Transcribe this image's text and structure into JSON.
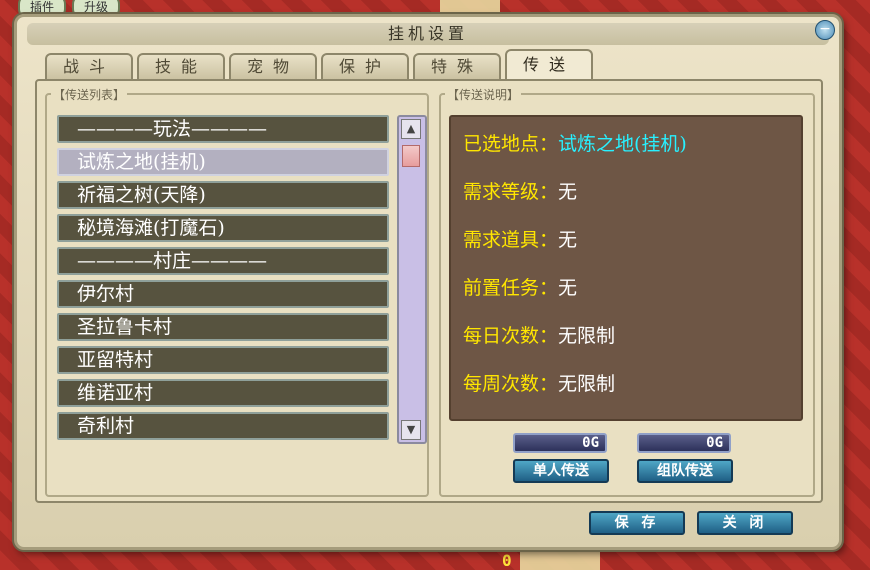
{
  "window": {
    "title": "挂机设置",
    "close_glyph": "−"
  },
  "background": {
    "top_buttons": [
      "插件",
      "升级"
    ],
    "bottom_number": "0"
  },
  "tabs": [
    {
      "label": "战斗",
      "active": false
    },
    {
      "label": "技能",
      "active": false
    },
    {
      "label": "宠物",
      "active": false
    },
    {
      "label": "保护",
      "active": false
    },
    {
      "label": "特殊",
      "active": false
    },
    {
      "label": "传送",
      "active": true
    }
  ],
  "teleport_list": {
    "group_label": "【传送列表】",
    "items": [
      {
        "label": "————玩法————",
        "type": "header"
      },
      {
        "label": "试炼之地(挂机)",
        "type": "item",
        "selected": true
      },
      {
        "label": "祈福之树(天降)",
        "type": "item"
      },
      {
        "label": "秘境海滩(打魔石)",
        "type": "item"
      },
      {
        "label": "————村庄————",
        "type": "header"
      },
      {
        "label": "伊尔村",
        "type": "item"
      },
      {
        "label": "圣拉鲁卡村",
        "type": "item"
      },
      {
        "label": "亚留特村",
        "type": "item"
      },
      {
        "label": "维诺亚村",
        "type": "item"
      },
      {
        "label": "奇利村",
        "type": "item"
      }
    ]
  },
  "description": {
    "group_label": "【传送说明】",
    "lines": [
      {
        "key": "已选地点：",
        "value": "试炼之地(挂机)"
      },
      {
        "key": "需求等级：",
        "value": "无"
      },
      {
        "key": "需求道具：",
        "value": "无"
      },
      {
        "key": "前置任务：",
        "value": "无"
      },
      {
        "key": "每日次数：",
        "value": "无限制"
      },
      {
        "key": "每周次数：",
        "value": "无限制"
      }
    ]
  },
  "gold": {
    "single": "0G",
    "team": "0G"
  },
  "buttons": {
    "single_teleport": "单人传送",
    "team_teleport": "组队传送",
    "save": "保 存",
    "close": "关 闭"
  },
  "colors": {
    "key_text": "#ffe600",
    "value_text": "#ffffff",
    "selected_location": "#28f0ff",
    "list_item_bg": "#57533f",
    "info_box_bg": "#6e5645",
    "button_blue": "#2f7ea6"
  }
}
